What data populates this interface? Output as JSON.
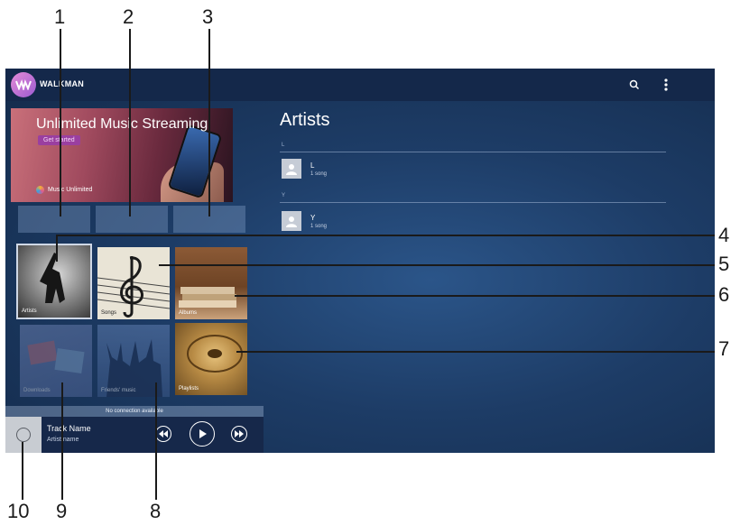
{
  "app": {
    "title": "WALKMAN"
  },
  "banner": {
    "title": "Unlimited Music Streaming",
    "cta": "Get started",
    "brand": "Music Unlimited"
  },
  "tiles": {
    "artists": "Artists",
    "songs": "Songs",
    "albums": "Albums",
    "playlists": "Playlists",
    "friends": "Friends' music",
    "downloads": "Downloads"
  },
  "status": "No connection available",
  "player": {
    "track": "Track Name",
    "artist": "Artist name"
  },
  "artists_view": {
    "title": "Artists",
    "groups": [
      {
        "letter": "L",
        "name": "L",
        "count": "1 song"
      },
      {
        "letter": "Y",
        "name": "Y",
        "count": "1 song"
      }
    ]
  },
  "callouts": [
    "1",
    "2",
    "3",
    "4",
    "5",
    "6",
    "7",
    "8",
    "9",
    "10"
  ],
  "colors": {
    "accent": "#9a3fa0",
    "bar": "#14284a",
    "background": "#1d3c66"
  },
  "icons": [
    "walkman-logo-icon",
    "search-icon",
    "overflow-menu-icon",
    "previous-icon",
    "play-icon",
    "next-icon",
    "person-icon",
    "disc-icon"
  ]
}
